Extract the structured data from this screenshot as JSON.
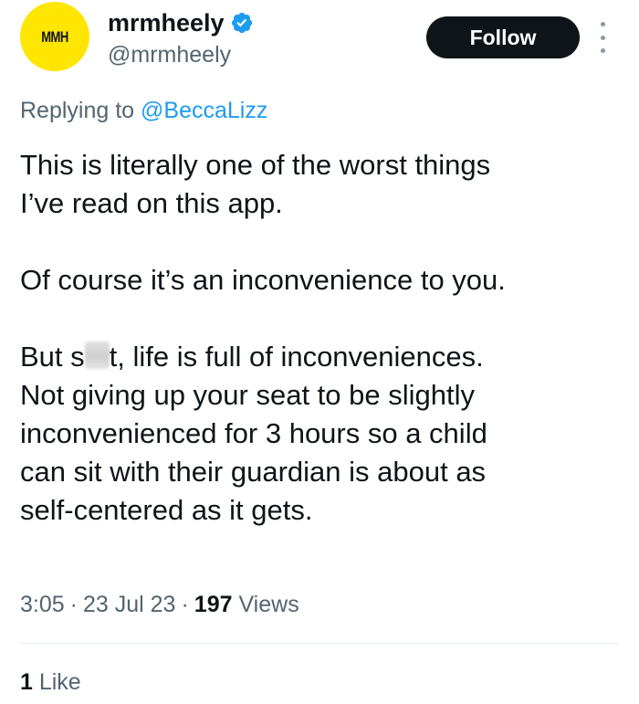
{
  "author": {
    "avatar_text": "MMH",
    "avatar_color": "#ffe600",
    "display_name": "mrmheely",
    "handle": "@mrmheely",
    "verified_icon": "verified-badge-icon",
    "verified_color": "#1d9bf0"
  },
  "actions": {
    "follow_label": "Follow",
    "more_icon": "more-vertical-icon"
  },
  "reply": {
    "prefix": "Replying to ",
    "mention": "@BeccaLizz"
  },
  "tweet": {
    "paragraph_1": "This is literally one of the worst things\nI’ve read on this app.",
    "paragraph_2": "Of course it’s an inconvenience to you.",
    "paragraph_3_start": "But s",
    "paragraph_3_after_censor": "t, life is full of inconveniences.",
    "paragraph_3_rest": "Not giving up your seat to be slightly\ninconvenienced for 3 hours so a child\ncan sit with their guardian is about as\nself-centered as it gets."
  },
  "meta": {
    "time": "3:05",
    "separator": "·",
    "date": "23 Jul 23",
    "views_count": "197",
    "views_label": " Views"
  },
  "engagement": {
    "likes_count": "1",
    "likes_label": " Like"
  },
  "colors": {
    "text_primary": "#0f1419",
    "text_secondary": "#536471",
    "link": "#1d9bf0",
    "button_bg": "#0f1419"
  }
}
